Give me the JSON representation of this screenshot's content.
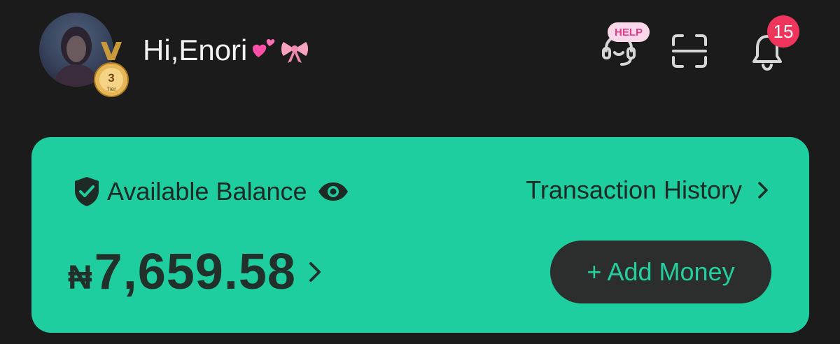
{
  "header": {
    "greeting": "Hi,Enori",
    "greeting_emojis": [
      "two-hearts",
      "ribbon"
    ],
    "tier": {
      "number": "3",
      "label": "Tier"
    },
    "help_label": "HELP",
    "notification_count": "15",
    "icons": [
      "support-headset-icon",
      "scan-icon",
      "bell-icon"
    ]
  },
  "balance_card": {
    "label": "Available Balance",
    "transaction_history_label": "Transaction History",
    "currency_symbol": "₦",
    "amount": "7,659.58",
    "add_money_label": "+ Add Money",
    "colors": {
      "card": "#1fce9f",
      "button": "#2b2e2d",
      "button_text": "#23cf9f"
    }
  }
}
